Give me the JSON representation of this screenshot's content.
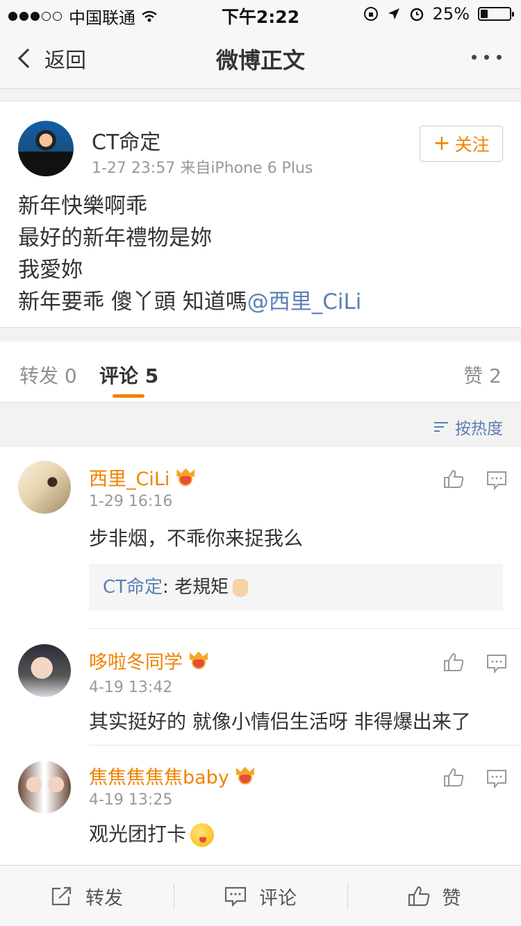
{
  "status_bar": {
    "carrier": "中国联通",
    "time": "下午2:22",
    "battery": "25%",
    "battery_level": 0.25
  },
  "nav": {
    "back_label": "返回",
    "title": "微博正文"
  },
  "post": {
    "author": "CT命定",
    "meta": "1-27 23:57  来自iPhone 6 Plus",
    "follow_label": "关注",
    "lines": [
      "新年快樂啊乖",
      "最好的新年禮物是妳",
      "我愛妳",
      "新年要乖 傻丫頭 知道嗎"
    ],
    "mention": "@西里_CiLi"
  },
  "tabs": {
    "repost": "转发 0",
    "comments": "评论 5",
    "likes": "赞 2"
  },
  "sort_label": "按热度",
  "comments": [
    {
      "name": "西里_CiLi",
      "time": "1-29 16:16",
      "text": "步非烟，不乖你来捉我么",
      "reply": {
        "name": "CT命定",
        "text": ": 老規矩"
      }
    },
    {
      "name": "哆啦冬同学",
      "time": "4-19 13:42",
      "text": "其实挺好的 就像小情侣生活呀 非得爆出来了"
    },
    {
      "name": "焦焦焦焦焦baby",
      "time": "4-19 13:25",
      "text": "观光团打卡"
    }
  ],
  "toolbar": {
    "repost": "转发",
    "comment": "评论",
    "like": "赞"
  },
  "colors": {
    "accent": "#f08200",
    "link": "#5b7fb4"
  }
}
